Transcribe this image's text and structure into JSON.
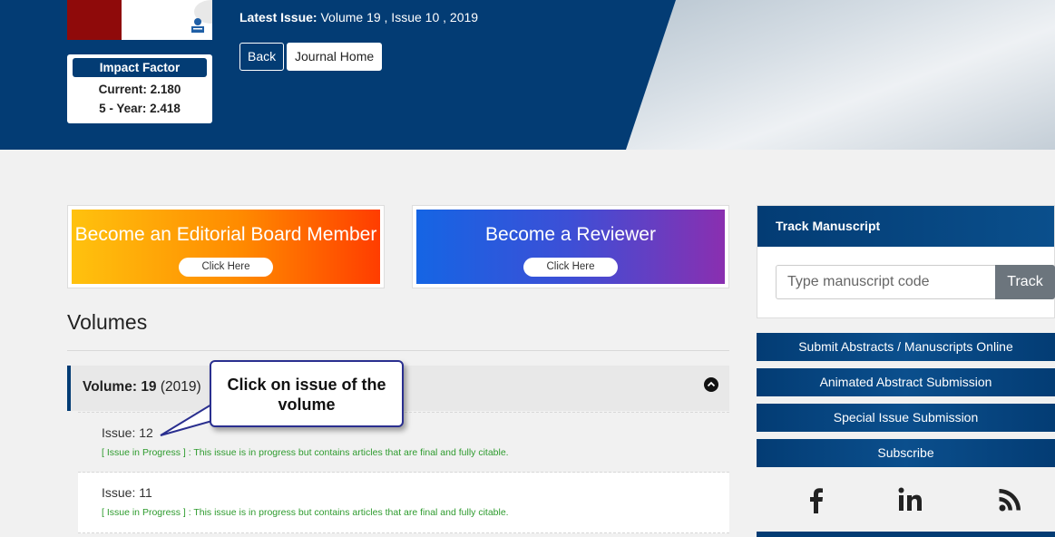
{
  "header": {
    "latest_label": "Latest Issue:",
    "latest_value": "Volume 19 , Issue 10 , 2019",
    "back_label": "Back",
    "home_label": "Journal Home"
  },
  "impact": {
    "title": "Impact Factor",
    "current": "Current: 2.180",
    "five_year": "5 - Year: 2.418"
  },
  "promos": {
    "editorial": {
      "title": "Become an Editorial Board Member",
      "cta": "Click Here"
    },
    "reviewer": {
      "title": "Become a Reviewer",
      "cta": "Click Here"
    }
  },
  "volumes": {
    "title": "Volumes",
    "current_volume": {
      "label": "Volume:",
      "number": "19",
      "year": "(2019)"
    },
    "issues": [
      {
        "name": "Issue: 12",
        "note": "[ Issue in Progress ] : This issue is in progress but contains articles that are final and fully citable."
      },
      {
        "name": "Issue: 11",
        "note": "[ Issue in Progress ] : This issue is in progress but contains articles that are final and fully citable."
      }
    ]
  },
  "callout": {
    "line1": "Click on issue of the",
    "line2": "volume"
  },
  "sidebar": {
    "track_title": "Track Manuscript",
    "track_placeholder": "Type manuscript code",
    "track_button": "Track",
    "buttons": [
      "Submit Abstracts / Manuscripts Online",
      "Animated Abstract Submission",
      "Special Issue Submission",
      "Subscribe"
    ],
    "social_icons": [
      "facebook-icon",
      "linkedin-icon",
      "rss-icon"
    ]
  },
  "colors": {
    "brand_navy": "#033c74",
    "note_green": "#2e9b2e",
    "track_gray": "#6c757d"
  }
}
